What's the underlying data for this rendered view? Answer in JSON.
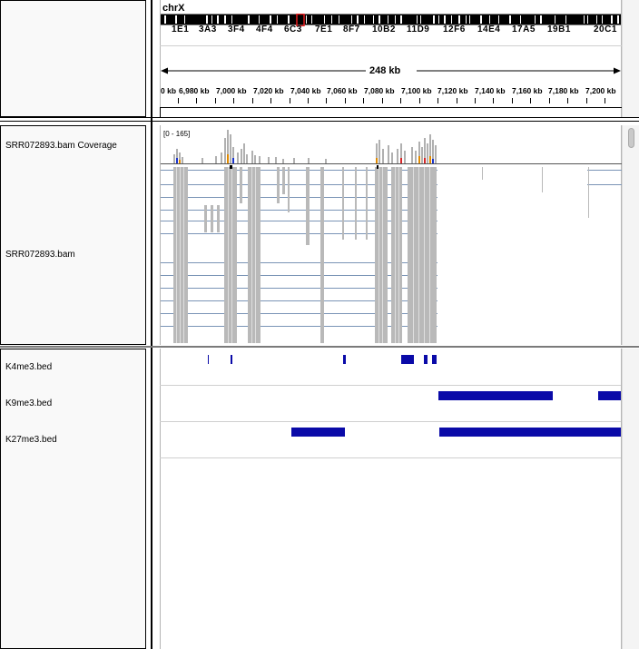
{
  "header": {
    "chromosome": "chrX",
    "span_label": "248 kb",
    "band_labels": [
      "1E1",
      "3A3",
      "3F4",
      "4F4",
      "6C3",
      "7E1",
      "8F7",
      "10B2",
      "11D9",
      "12F6",
      "14E4",
      "17A5",
      "19B1",
      "20C1"
    ],
    "ruler_labels": [
      "0 kb",
      "6,980 kb",
      "7,000 kb",
      "7,020 kb",
      "7,040 kb",
      "7,060 kb",
      "7,080 kb",
      "7,100 kb",
      "7,120 kb",
      "7,140 kb",
      "7,160 kb",
      "7,180 kb",
      "7,200 kb"
    ]
  },
  "tracks": {
    "coverage": {
      "name": "SRR072893.bam Coverage",
      "range": "[0 - 165]"
    },
    "alignments": {
      "name": "SRR072893.bam"
    },
    "features": [
      {
        "name": "K4me3.bed"
      },
      {
        "name": "K9me3.bed"
      },
      {
        "name": "K27me3.bed"
      }
    ]
  },
  "colors": {
    "feature": "#0a0aa8",
    "read": "#b9b9b9",
    "locator": "#e41a1c",
    "coverage": "#b0b0b0"
  }
}
